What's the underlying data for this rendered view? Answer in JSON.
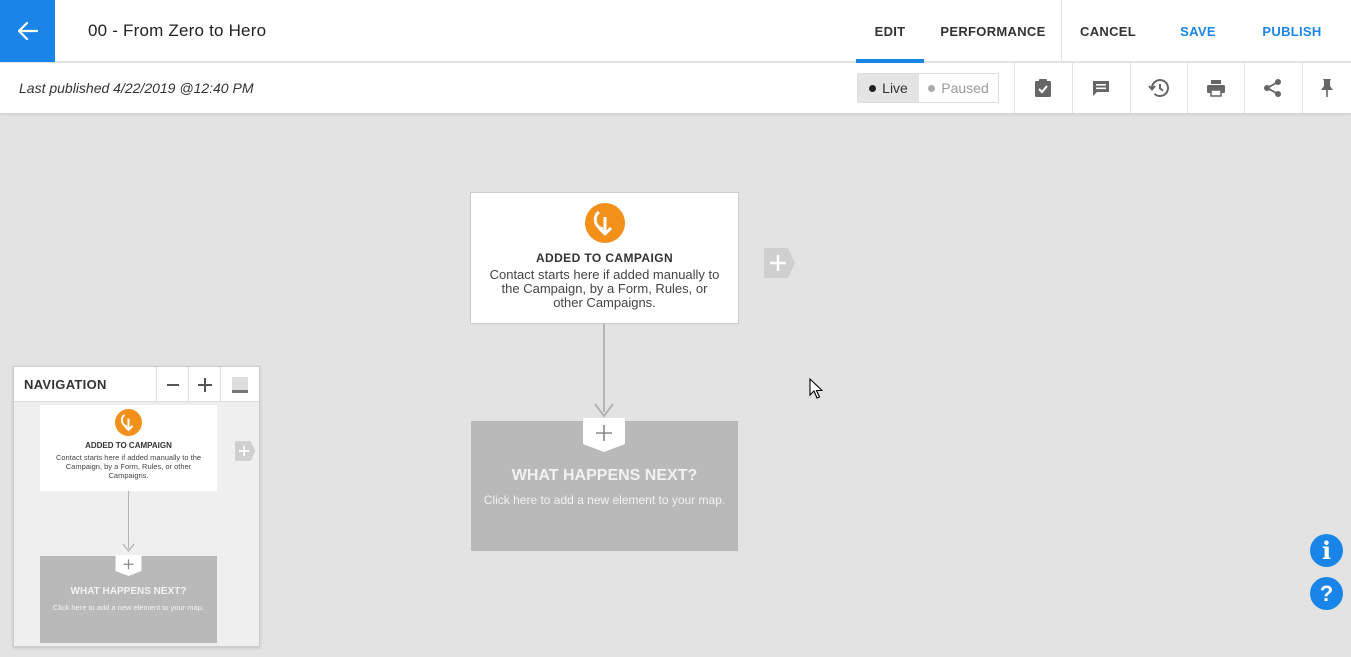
{
  "header": {
    "title": "00 - From Zero to Hero",
    "tabs": [
      {
        "label": "EDIT",
        "active": true
      },
      {
        "label": "PERFORMANCE",
        "active": false
      }
    ],
    "cancel_label": "CANCEL",
    "save_label": "SAVE",
    "publish_label": "PUBLISH"
  },
  "subbar": {
    "last_published": "Last published 4/22/2019 @12:40 PM",
    "status": {
      "live_label": "Live",
      "paused_label": "Paused",
      "selected": "Live"
    },
    "tools": [
      "checklist-icon",
      "comment-icon",
      "history-icon",
      "print-icon",
      "share-icon",
      "pin-icon"
    ]
  },
  "canvas": {
    "start_card": {
      "title": "ADDED TO CAMPAIGN",
      "description": "Contact starts here if added manually to the Campaign, by a Form, Rules, or other Campaigns."
    },
    "next_card": {
      "title": "WHAT HAPPENS NEXT?",
      "description": "Click here to add a new element to your map."
    }
  },
  "navigation": {
    "title": "NAVIGATION",
    "mini_start_title": "ADDED TO CAMPAIGN",
    "mini_start_desc": "Contact starts here if added manually to the Campaign, by a Form, Rules, or other Campaigns.",
    "mini_next_title": "WHAT HAPPENS NEXT?",
    "mini_next_desc": "Click here to add a new element to your map."
  },
  "colors": {
    "accent": "#1a85e8",
    "start_icon": "#f39019",
    "canvas_bg": "#e3e3e3",
    "next_card_bg": "#b9b9b9"
  }
}
